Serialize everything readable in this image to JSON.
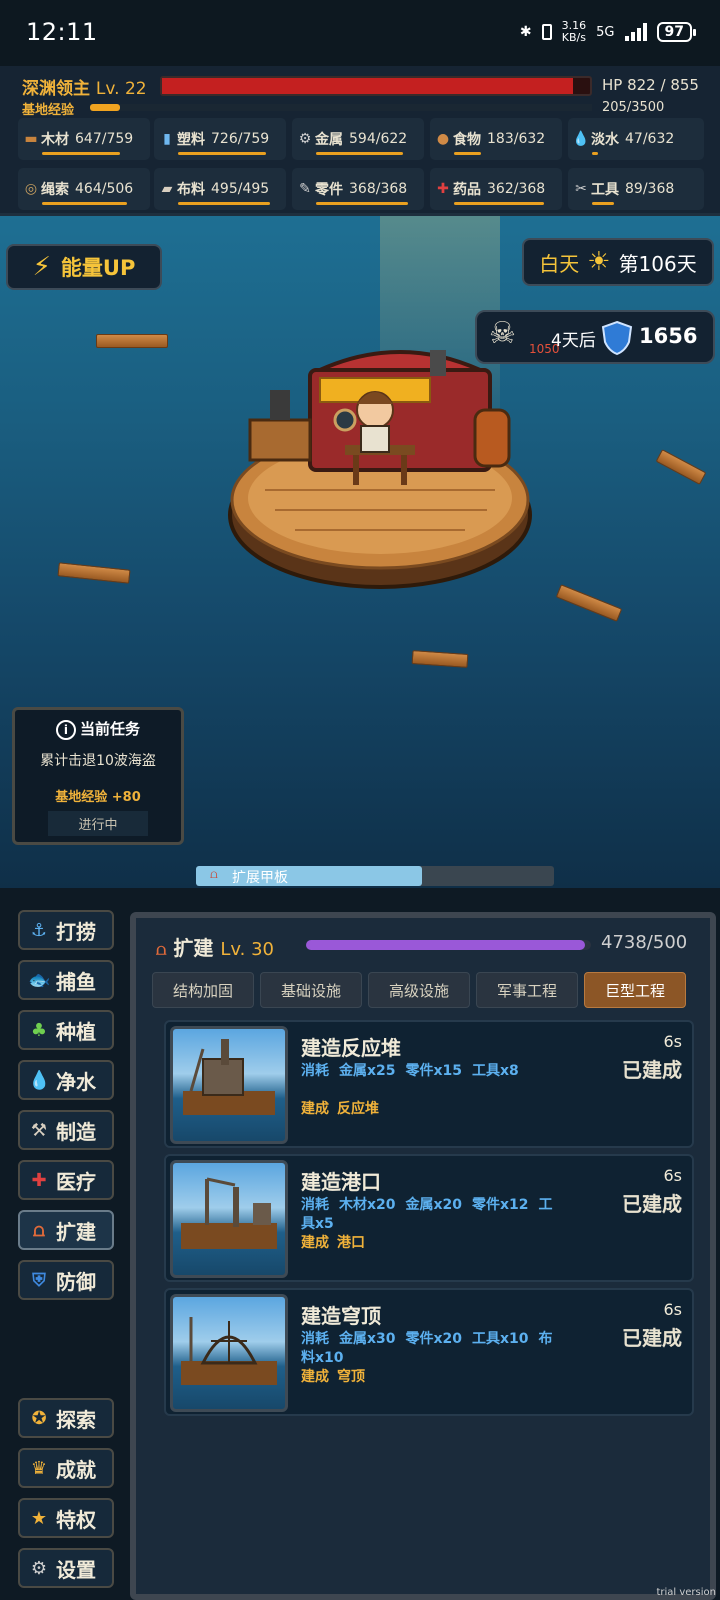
{
  "status_bar": {
    "time": "12:11",
    "net_speed": "3.16",
    "net_unit": "KB/s",
    "network": "5G",
    "battery": "97"
  },
  "player": {
    "name": "深渊领主",
    "level_label": "Lv. 22",
    "hp_label": "HP 822 / 855",
    "hp_fraction": 0.96,
    "exp_label": "基地经验",
    "exp_text": "205/3500",
    "exp_fraction": 0.06
  },
  "resources": [
    {
      "icon": "wood-icon",
      "label": "木材",
      "value": "647/759",
      "fraction": 0.85
    },
    {
      "icon": "plastic-icon",
      "label": "塑料",
      "value": "726/759",
      "fraction": 0.96
    },
    {
      "icon": "metal-icon",
      "label": "金属",
      "value": "594/622",
      "fraction": 0.95
    },
    {
      "icon": "food-icon",
      "label": "食物",
      "value": "183/632",
      "fraction": 0.29
    },
    {
      "icon": "water-drop-icon",
      "label": "淡水",
      "value": "47/632",
      "fraction": 0.07
    },
    {
      "icon": "rope-icon",
      "label": "绳索",
      "value": "464/506",
      "fraction": 0.92
    },
    {
      "icon": "cloth-icon",
      "label": "布料",
      "value": "495/495",
      "fraction": 1.0
    },
    {
      "icon": "parts-icon",
      "label": "零件",
      "value": "368/368",
      "fraction": 1.0
    },
    {
      "icon": "medkit-icon",
      "label": "药品",
      "value": "362/368",
      "fraction": 0.98
    },
    {
      "icon": "wrench-icon",
      "label": "工具",
      "value": "89/368",
      "fraction": 0.24
    }
  ],
  "energy_button": {
    "label": "能量UP"
  },
  "day": {
    "phase": "白天",
    "number": "第106天"
  },
  "pirate": {
    "level": "1050",
    "eta": "4天后",
    "defense": "1656"
  },
  "quest": {
    "title": "当前任务",
    "desc": "累计击退10波海盗",
    "reward": "基地经验 +80",
    "status": "进行中"
  },
  "expand": {
    "label": "扩展甲板",
    "fraction": 0.63
  },
  "side_menu": [
    {
      "icon": "anchor-icon",
      "label": "打捞"
    },
    {
      "icon": "fish-icon",
      "label": "捕鱼"
    },
    {
      "icon": "sprout-icon",
      "label": "种植"
    },
    {
      "icon": "water-drop-icon",
      "label": "净水"
    },
    {
      "icon": "hammer-icon",
      "label": "制造"
    },
    {
      "icon": "medkit-icon",
      "label": "医疗"
    },
    {
      "icon": "gate-icon",
      "label": "扩建"
    },
    {
      "icon": "shield-icon",
      "label": "防御"
    }
  ],
  "side_menu_bottom": [
    {
      "icon": "compass-icon",
      "label": "探索"
    },
    {
      "icon": "trophy-icon",
      "label": "成就"
    },
    {
      "icon": "star-icon",
      "label": "特权"
    },
    {
      "icon": "gear-icon",
      "label": "设置"
    }
  ],
  "build_panel": {
    "title": "扩建",
    "level": "Lv. 30",
    "progress_text": "4738/500",
    "progress_fraction": 0.98,
    "tabs": [
      "结构加固",
      "基础设施",
      "高级设施",
      "军事工程",
      "巨型工程"
    ],
    "active_tab": 4,
    "cards": [
      {
        "name": "建造反应堆",
        "cost_prefix": "消耗",
        "costs": [
          "金属x25",
          "零件x15",
          "工具x8"
        ],
        "result_prefix": "建成",
        "result": "反应堆",
        "time": "6s",
        "status": "已建成"
      },
      {
        "name": "建造港口",
        "cost_prefix": "消耗",
        "costs": [
          "木材x20",
          "金属x20",
          "零件x12",
          "工具x5"
        ],
        "result_prefix": "建成",
        "result": "港口",
        "time": "6s",
        "status": "已建成"
      },
      {
        "name": "建造穹顶",
        "cost_prefix": "消耗",
        "costs": [
          "金属x30",
          "零件x20",
          "工具x10",
          "布料x10"
        ],
        "result_prefix": "建成",
        "result": "穹顶",
        "time": "6s",
        "status": "已建成"
      }
    ]
  },
  "watermark": "trial version",
  "colors": {
    "accent": "#f0b23a",
    "hp": "#c42020",
    "cost": "#5cb0ef",
    "progress": "#9a58d8"
  }
}
